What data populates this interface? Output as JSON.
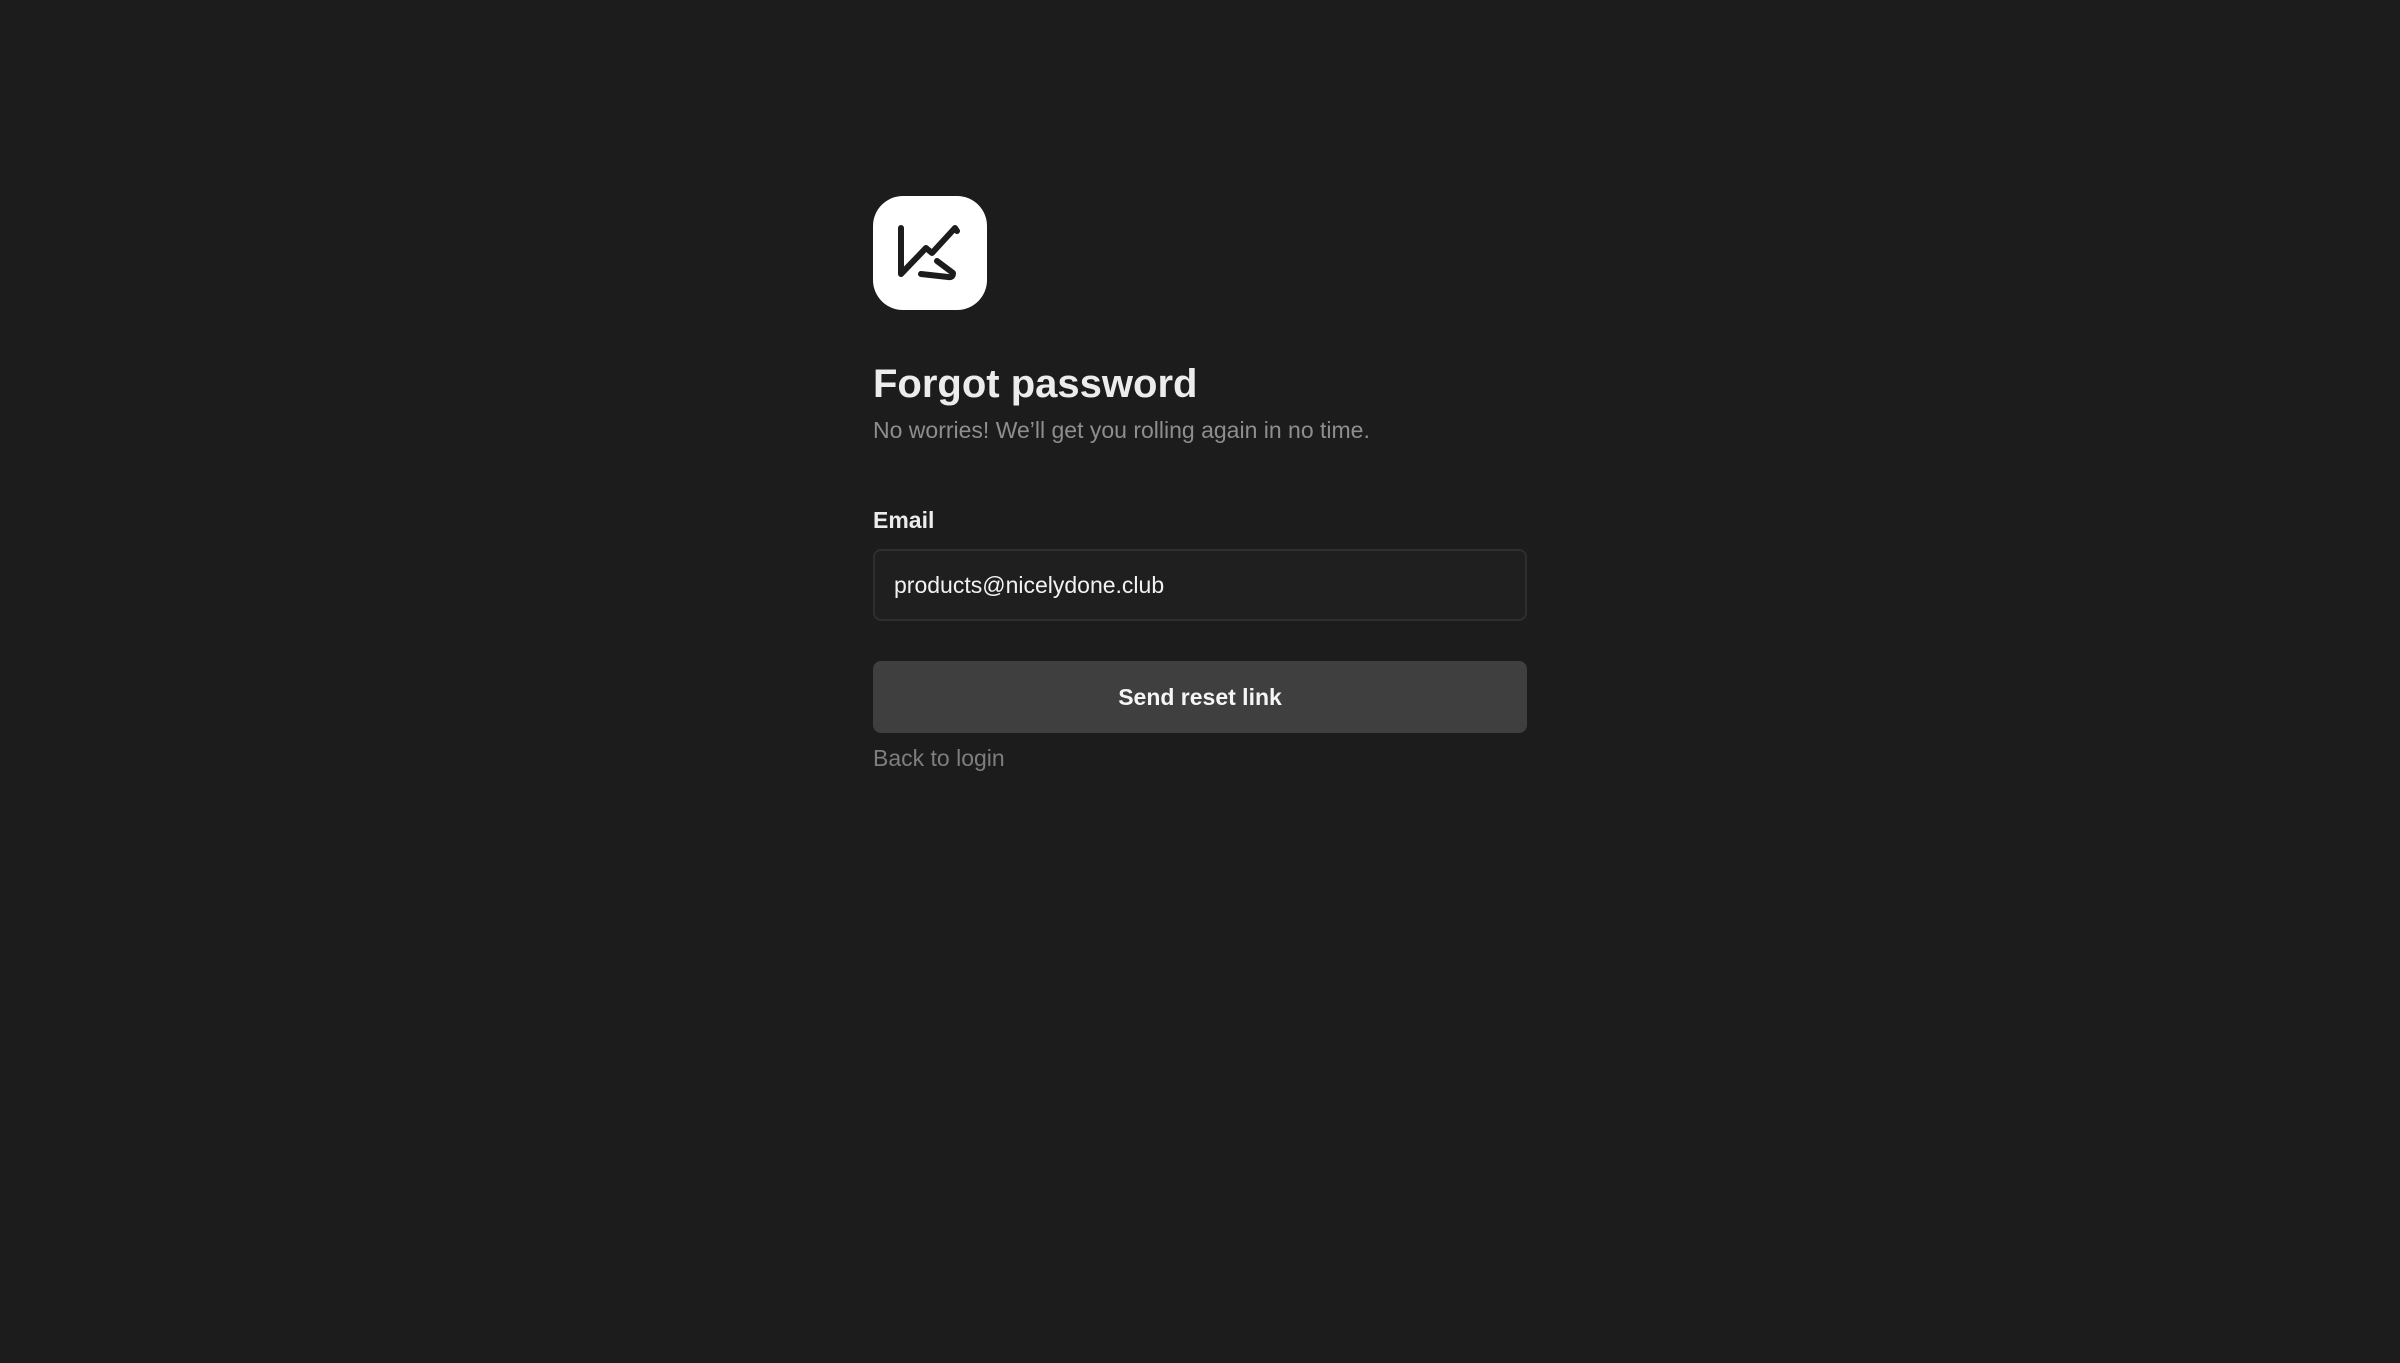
{
  "logo": {
    "icon": "brand-logo-icon"
  },
  "header": {
    "title": "Forgot password",
    "subtitle": "No worries! We’ll get you rolling again in no time."
  },
  "form": {
    "email_label": "Email",
    "email_value": "products@nicelydone.club",
    "submit_label": "Send reset link"
  },
  "footer": {
    "back_link": "Back to login"
  },
  "colors": {
    "background": "#1c1c1c",
    "button": "#3f3f3f",
    "muted_text": "#8e8e8e"
  }
}
